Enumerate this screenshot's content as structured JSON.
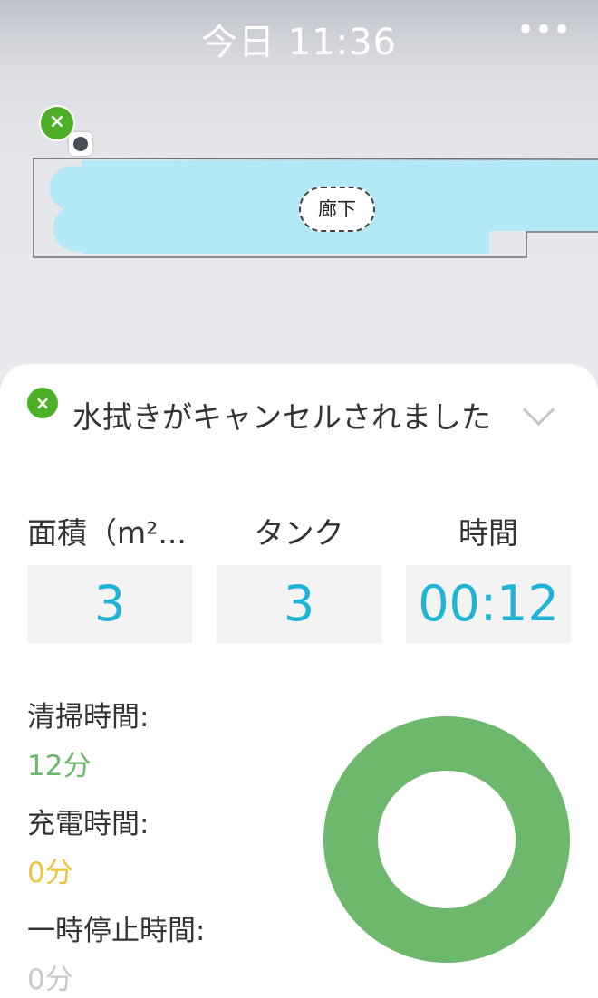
{
  "header": {
    "title": "今日 11:36",
    "more_icon": "more-dots-icon",
    "more_glyph": "•••"
  },
  "map": {
    "room_label": "廊下",
    "marker_icon": "cancel-marker-icon",
    "marker_glyph": "×",
    "dock_icon": "charging-dock-icon",
    "cleaned_color": "#b3e8f6"
  },
  "status": {
    "icon": "cancel-circle-icon",
    "glyph": "×",
    "text": "水拭きがキャンセルされました",
    "expand_icon": "chevron-down-icon"
  },
  "stats": [
    {
      "label": "面積（m²...",
      "value": "3"
    },
    {
      "label": "タンク",
      "value": "3"
    },
    {
      "label": "時間",
      "value": "00:12"
    }
  ],
  "time_breakdown": [
    {
      "label": "清掃時間:",
      "value": "12分",
      "color": "#6db86c"
    },
    {
      "label": "充電時間:",
      "value": "0分",
      "color": "#efc43b"
    },
    {
      "label": "一時停止時間:",
      "value": "0分",
      "color": "#c9c9c9"
    }
  ],
  "donut_chart": {
    "type": "pie",
    "segments": [
      {
        "label": "清掃時間",
        "value": 12,
        "color": "#6db86c"
      },
      {
        "label": "充電時間",
        "value": 0,
        "color": "#efc43b"
      },
      {
        "label": "一時停止時間",
        "value": 0,
        "color": "#c9c9c9"
      }
    ]
  },
  "colors": {
    "accent_value": "#21b3d7",
    "status_green": "#4caf26"
  }
}
